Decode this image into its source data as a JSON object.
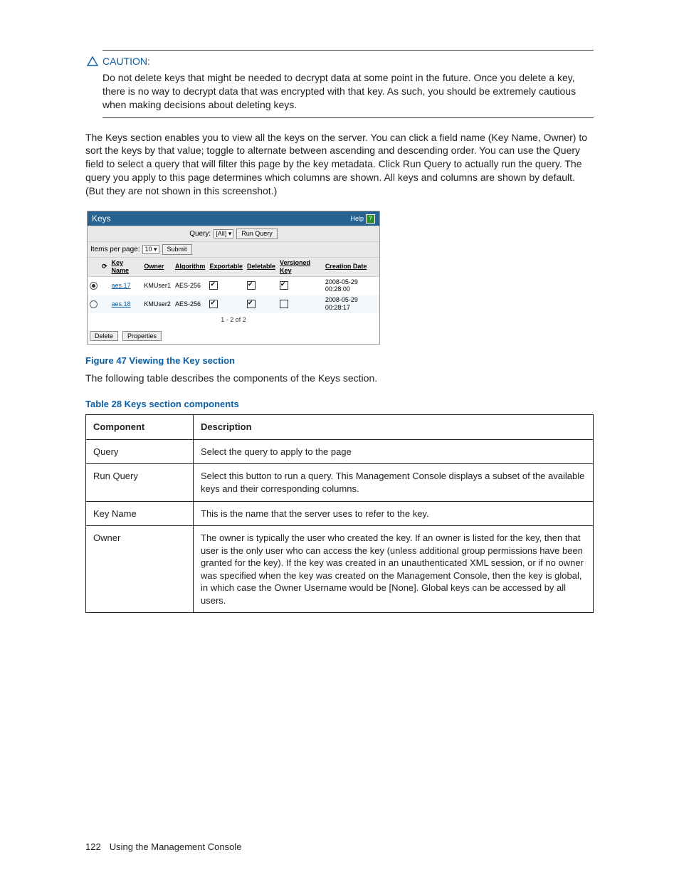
{
  "caution": {
    "label": "CAUTION:",
    "text": "Do not delete keys that might be needed to decrypt data at some point in the future. Once you delete a key, there is no way to decrypt data that was encrypted with that key. As such, you should be extremely cautious when making decisions about deleting keys."
  },
  "intro": "The Keys section enables you to view all the keys on the server. You can click a field name (Key Name, Owner) to sort the keys by that value; toggle to alternate between ascending and descending order. You can use the Query field to select a query that will filter this page by the key metadata. Click Run Query to actually run the query. The query you apply to this page determines which columns are shown. All keys and columns are shown by default. (But they are not shown in this screenshot.)",
  "screenshot": {
    "title": "Keys",
    "help_label": "Help",
    "query_label": "Query:",
    "query_value": "[All]",
    "run_query_btn": "Run Query",
    "items_label": "Items per page:",
    "items_value": "10",
    "submit_btn": "Submit",
    "columns": {
      "keyname": "Key Name",
      "owner": "Owner",
      "algorithm": "Algorithm",
      "exportable": "Exportable",
      "deletable": "Deletable",
      "versioned": "Versioned Key",
      "creation": "Creation Date"
    },
    "rows": [
      {
        "selected": true,
        "keyname": "aes.17",
        "owner": "KMUser1",
        "algorithm": "AES-256",
        "exportable": true,
        "deletable": true,
        "versioned": true,
        "creation": "2008-05-29 00:28:00"
      },
      {
        "selected": false,
        "keyname": "aes.18",
        "owner": "KMUser2",
        "algorithm": "AES-256",
        "exportable": true,
        "deletable": true,
        "versioned": false,
        "creation": "2008-05-29 00:28:17"
      }
    ],
    "pager": "1 - 2 of 2",
    "delete_btn": "Delete",
    "properties_btn": "Properties"
  },
  "figure_caption": "Figure 47 Viewing the Key section",
  "figure_followup": "The following table describes the components of the Keys section.",
  "table_caption": "Table 28 Keys section components",
  "component_table": {
    "head_component": "Component",
    "head_description": "Description",
    "rows": [
      {
        "c": "Query",
        "d": "Select the query to apply to the page"
      },
      {
        "c": "Run Query",
        "d": "Select this button to run a query. This Management Console displays a subset of the available keys and their corresponding columns."
      },
      {
        "c": "Key Name",
        "d": "This is the name that the server uses to refer to the key."
      },
      {
        "c": "Owner",
        "d": "The owner is typically the user who created the key. If an owner is listed for the key, then that user is the only user who can access the key (unless additional group permissions have been granted for the key). If the key was created in an unauthenticated XML session, or if no owner was specified when the key was created on the Management Console, then the key is global, in which case the Owner Username would be [None]. Global keys can be accessed by all users."
      }
    ]
  },
  "footer": {
    "page": "122",
    "section": "Using the Management Console"
  }
}
